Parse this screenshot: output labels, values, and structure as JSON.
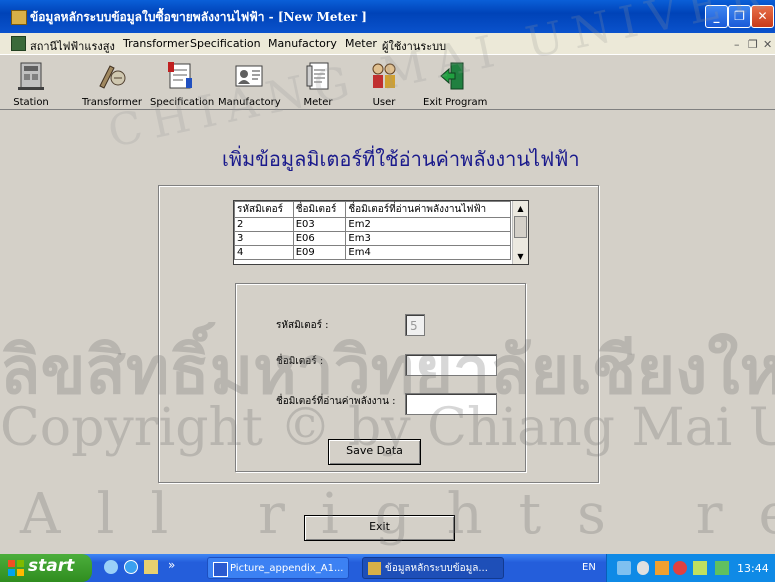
{
  "window": {
    "title": "ข้อมูลหลักระบบข้อมูลใบซื้อขายพลังงานไฟฟ้า - [New Meter ]",
    "min_label": "_",
    "max_label": "❐",
    "close_label": "✕"
  },
  "menubar": {
    "items": [
      "สถานีไฟฟ้าแรงสูง",
      "Transformer",
      "Specification",
      "Manufactory",
      "Meter",
      "ผู้ใช้งานระบบ"
    ],
    "mdi_min": "–",
    "mdi_restore": "❐",
    "mdi_close": "✕"
  },
  "toolbar": {
    "items": [
      {
        "label": "Station",
        "icon": "station-icon"
      },
      {
        "label": "Transformer",
        "icon": "transformer-icon"
      },
      {
        "label": "Specification",
        "icon": "specification-icon"
      },
      {
        "label": "Manufactory",
        "icon": "manufactory-icon"
      },
      {
        "label": "Meter",
        "icon": "meter-icon"
      },
      {
        "label": "User",
        "icon": "user-icon"
      },
      {
        "label": "Exit Program",
        "icon": "exit-program-icon"
      }
    ]
  },
  "form": {
    "heading": "เพิ่มข้อมูลมิเตอร์ที่ใช้อ่านค่าพลังงานไฟฟ้า",
    "grid": {
      "columns": [
        "รหัสมิเตอร์",
        "ชื่อมิเตอร์",
        "ชื่อมิเตอร์ที่อ่านค่าพลังงานไฟฟ้า"
      ],
      "rows": [
        [
          "2",
          "E03",
          "Em2"
        ],
        [
          "3",
          "E06",
          "Em3"
        ],
        [
          "4",
          "E09",
          "Em4"
        ]
      ]
    },
    "meter_id_label": "รหัสมิเตอร์ :",
    "meter_id_value": "5",
    "meter_name_label": "ชื่อมิเตอร์ :",
    "meter_name_value": "",
    "meter_reading_label": "ชื่อมิเตอร์ที่อ่านค่าพลังงาน :",
    "meter_reading_value": "",
    "save_label": "Save Data",
    "exit_label": "Exit"
  },
  "watermark": {
    "line1": "ลิขสิทธิ์มหาวิทยาลัยเชียงใหม่",
    "line2": "Copyright © by Chiang Mai University",
    "line3": "All rights reserved",
    "arc": "CHIANG MAI UNIVERSITY"
  },
  "taskbar": {
    "start_label": "start",
    "tasks": [
      "Picture_appendix_A1...",
      "ข้อมูลหลักระบบข้อมูล..."
    ],
    "chevron": "»",
    "lang": "EN",
    "clock": "13:44"
  }
}
